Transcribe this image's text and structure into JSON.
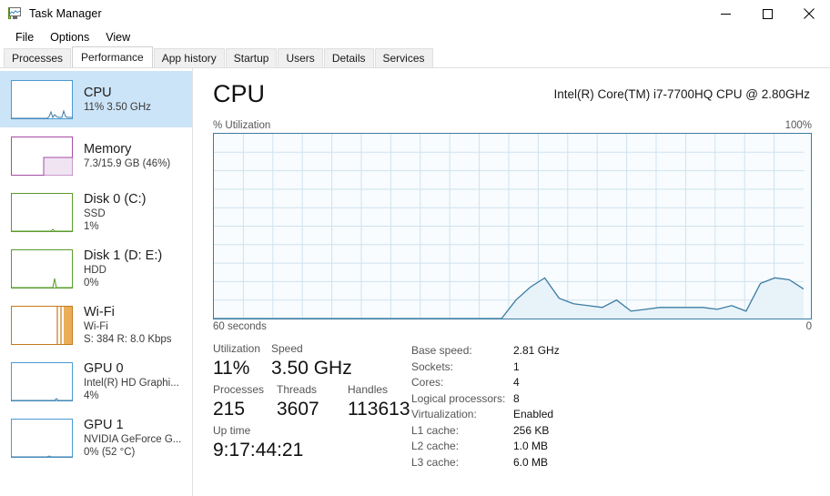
{
  "window": {
    "title": "Task Manager",
    "icon": "task-manager-icon",
    "controls": {
      "minimize": "minimize",
      "maximize": "maximize",
      "close": "close"
    }
  },
  "menu": {
    "items": [
      "File",
      "Options",
      "View"
    ]
  },
  "tabs": {
    "items": [
      "Processes",
      "Performance",
      "App history",
      "Startup",
      "Users",
      "Details",
      "Services"
    ],
    "active": "Performance"
  },
  "sidebar": {
    "items": [
      {
        "name": "CPU",
        "line1": "11%  3.50 GHz",
        "line2": "",
        "color": "#4a9ad4",
        "selected": true,
        "thumb": "cpu"
      },
      {
        "name": "Memory",
        "line1": "7.3/15.9 GB (46%)",
        "line2": "",
        "color": "#a64ca6",
        "selected": false,
        "thumb": "memory"
      },
      {
        "name": "Disk 0 (C:)",
        "line1": "SSD",
        "line2": "1%",
        "color": "#5a9b2a",
        "selected": false,
        "thumb": "disk0"
      },
      {
        "name": "Disk 1 (D: E:)",
        "line1": "HDD",
        "line2": "0%",
        "color": "#5a9b2a",
        "selected": false,
        "thumb": "disk1"
      },
      {
        "name": "Wi-Fi",
        "line1": "Wi-Fi",
        "line2": "S: 384 R: 8.0 Kbps",
        "color": "#c47a18",
        "selected": false,
        "thumb": "wifi"
      },
      {
        "name": "GPU 0",
        "line1": "Intel(R) HD Graphi...",
        "line2": "4%",
        "color": "#4a9ad4",
        "selected": false,
        "thumb": "gpu0"
      },
      {
        "name": "GPU 1",
        "line1": "NVIDIA GeForce G...",
        "line2": "0%  (52 °C)",
        "color": "#4a9ad4",
        "selected": false,
        "thumb": "gpu1"
      }
    ]
  },
  "main": {
    "title": "CPU",
    "model": "Intel(R) Core(TM) i7-7700HQ CPU @ 2.80GHz",
    "graph_label_left": "% Utilization",
    "graph_label_right": "100%",
    "time_label_left": "60 seconds",
    "time_label_right": "0",
    "stats_left": [
      [
        {
          "label": "Utilization",
          "value": "11%"
        },
        {
          "label": "Speed",
          "value": "3.50 GHz"
        }
      ],
      [
        {
          "label": "Processes",
          "value": "215"
        },
        {
          "label": "Threads",
          "value": "3607"
        },
        {
          "label": "Handles",
          "value": "113613"
        }
      ],
      [
        {
          "label": "Up time",
          "value": "9:17:44:21"
        }
      ]
    ],
    "stats_right": [
      {
        "key": "Base speed:",
        "value": "2.81 GHz"
      },
      {
        "key": "Sockets:",
        "value": "1"
      },
      {
        "key": "Cores:",
        "value": "4"
      },
      {
        "key": "Logical processors:",
        "value": "8"
      },
      {
        "key": "Virtualization:",
        "value": "Enabled"
      },
      {
        "key": "L1 cache:",
        "value": "256 KB"
      },
      {
        "key": "L2 cache:",
        "value": "1.0 MB"
      },
      {
        "key": "L3 cache:",
        "value": "6.0 MB"
      }
    ]
  },
  "chart_data": {
    "type": "area",
    "title": "CPU % Utilization",
    "xlabel": "seconds",
    "ylabel": "% Utilization",
    "ylim": [
      0,
      100
    ],
    "xlim": [
      60,
      0
    ],
    "grid": true,
    "line_color": "#3b7ca3",
    "fill_color": "#e8f2f9",
    "legend": "none",
    "x": [
      60,
      58,
      56,
      54,
      52,
      50,
      48,
      46,
      44,
      42,
      40,
      38,
      36,
      34,
      32,
      30,
      28,
      26,
      24,
      22,
      21,
      20,
      19,
      18,
      17,
      16,
      15,
      14,
      13,
      12,
      11,
      10,
      9,
      8,
      7,
      6,
      5,
      4,
      3,
      2,
      1,
      0
    ],
    "values": [
      0,
      0,
      0,
      0,
      0,
      0,
      0,
      0,
      0,
      0,
      0,
      0,
      0,
      0,
      0,
      0,
      0,
      0,
      0,
      0,
      0,
      10,
      17,
      22,
      11,
      8,
      7,
      6,
      10,
      4,
      5,
      6,
      6,
      6,
      6,
      5,
      7,
      4,
      19,
      22,
      21,
      16
    ]
  }
}
